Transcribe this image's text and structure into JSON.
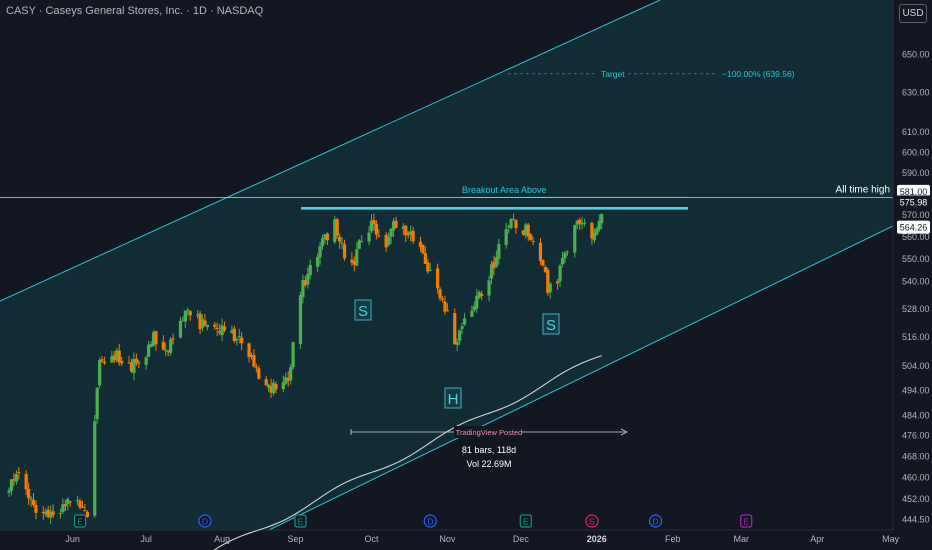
{
  "header": {
    "title": "CASY · Caseys General Stores, Inc. · 1D · NASDAQ",
    "currency": "USD"
  },
  "colors": {
    "up": "#4caf50",
    "down": "#f57c00",
    "channel": "#26c6da",
    "resistance": "#4dd0e1",
    "ma": "#d1d4dc",
    "background": "#131722",
    "pattern_label": "#4dd0e1",
    "posted": "#f48fb1"
  },
  "annotations": {
    "target_label": "Target",
    "target_value": "−100.00% (639.56)",
    "breakout_label": "Breakout Area Above",
    "ath_label": "All time high",
    "posted_label": "TradingView Posted",
    "range_bars": "81 bars, 118d",
    "range_vol": "Vol 22.69M",
    "pattern_left": "S",
    "pattern_head": "H",
    "pattern_right": "S"
  },
  "chart_data": {
    "type": "candlestick",
    "title": "CASY · Caseys General Stores, Inc. · 1D · NASDAQ",
    "y_scale": "log",
    "y_ticks": [
      "650.00",
      "630.00",
      "610.00",
      "600.00",
      "590.00",
      "570.00",
      "560.00",
      "550.00",
      "540.00",
      "528.00",
      "516.00",
      "504.00",
      "494.00",
      "484.00",
      "476.00",
      "468.00",
      "460.00",
      "452.00",
      "444.50"
    ],
    "x_ticks": [
      "Jun",
      "Jul",
      "Aug",
      "Sep",
      "Oct",
      "Nov",
      "Dec",
      "2026",
      "Feb",
      "Mar",
      "Apr",
      "May"
    ],
    "price_labels": [
      {
        "text": "581.00",
        "value": 581.0,
        "style": "ath"
      },
      {
        "text": "575.98",
        "value": 575.98,
        "style": "plain"
      },
      {
        "text": "564.26",
        "value": 564.26,
        "style": "last"
      }
    ],
    "resistance_level": 573,
    "ath_level": 578,
    "target_value": 639.56,
    "breakout_value": 582,
    "events": [
      {
        "label": "E",
        "date": "2025-06-10",
        "color": "#089981"
      },
      {
        "label": "D",
        "date": "2025-07-31",
        "color": "#2962ff"
      },
      {
        "label": "E",
        "date": "2025-09-08",
        "color": "#089981"
      },
      {
        "label": "D",
        "date": "2025-10-31",
        "color": "#2962ff"
      },
      {
        "label": "E",
        "date": "2025-12-09",
        "color": "#089981"
      },
      {
        "label": "S",
        "date": "2026-01-05",
        "color": "#e91e63"
      },
      {
        "label": "D",
        "date": "2026-01-31",
        "color": "#2962ff"
      },
      {
        "label": "E",
        "date": "2026-03-09",
        "color": "#9c27b0"
      }
    ],
    "waypoints": [
      [
        "2025-05-12",
        455
      ],
      [
        "2025-05-16",
        462
      ],
      [
        "2025-05-22",
        450
      ],
      [
        "2025-05-28",
        446
      ],
      [
        "2025-06-02",
        448
      ],
      [
        "2025-06-06",
        452
      ],
      [
        "2025-06-10",
        449
      ],
      [
        "2025-06-13",
        444
      ],
      [
        "2025-06-18",
        505
      ],
      [
        "2025-06-24",
        508
      ],
      [
        "2025-07-01",
        504
      ],
      [
        "2025-07-07",
        510
      ],
      [
        "2025-07-10",
        515
      ],
      [
        "2025-07-16",
        512
      ],
      [
        "2025-07-23",
        525
      ],
      [
        "2025-07-29",
        522
      ],
      [
        "2025-08-05",
        520
      ],
      [
        "2025-08-12",
        517
      ],
      [
        "2025-08-18",
        510
      ],
      [
        "2025-08-22",
        497
      ],
      [
        "2025-08-28",
        494
      ],
      [
        "2025-09-03",
        500
      ],
      [
        "2025-09-05",
        512
      ],
      [
        "2025-09-09",
        538
      ],
      [
        "2025-09-12",
        548
      ],
      [
        "2025-09-17",
        556
      ],
      [
        "2025-09-22",
        566
      ],
      [
        "2025-09-26",
        551
      ],
      [
        "2025-09-30",
        550
      ],
      [
        "2025-10-03",
        561
      ],
      [
        "2025-10-08",
        565
      ],
      [
        "2025-10-13",
        557
      ],
      [
        "2025-10-17",
        566
      ],
      [
        "2025-10-22",
        561
      ],
      [
        "2025-10-28",
        551
      ],
      [
        "2025-11-03",
        537
      ],
      [
        "2025-11-06",
        528
      ],
      [
        "2025-11-10",
        514
      ],
      [
        "2025-11-13",
        521
      ],
      [
        "2025-11-19",
        531
      ],
      [
        "2025-11-25",
        545
      ],
      [
        "2025-11-28",
        555
      ],
      [
        "2025-12-03",
        569
      ],
      [
        "2025-12-08",
        564
      ],
      [
        "2025-12-11",
        560
      ],
      [
        "2025-12-15",
        550
      ],
      [
        "2025-12-18",
        537
      ],
      [
        "2025-12-22",
        542
      ],
      [
        "2025-12-26",
        552
      ],
      [
        "2025-12-30",
        566
      ],
      [
        "2026-01-02",
        568
      ],
      [
        "2026-01-06",
        560
      ],
      [
        "2026-01-09",
        568
      ]
    ],
    "range_note": "81 bars, 118d",
    "range_volume": "Vol 22.69M"
  }
}
